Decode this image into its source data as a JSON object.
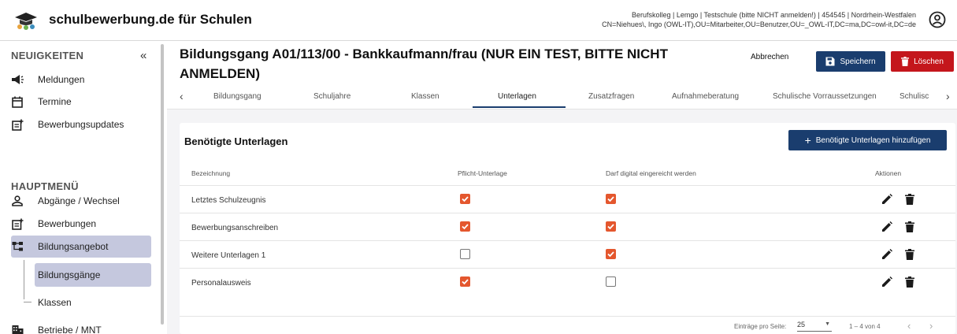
{
  "header": {
    "brand": "schulbewerbung.de für Schulen",
    "user_line1": "Berufskolleg | Lemgo | Testschule (bitte NICHT anmelden!) | 454545 | Nordrhein-Westfalen",
    "user_line2": "CN=Niehues\\, Ingo (OWL-IT),OU=Mitarbeiter,OU=Benutzer,OU=_OWL-IT,DC=ma,DC=owl-it,DC=de"
  },
  "sidebar": {
    "news_heading": "NEUIGKEITEN",
    "collapse_icon": "«",
    "news_items": [
      {
        "label": "Meldungen",
        "icon": "megaphone-icon"
      },
      {
        "label": "Termine",
        "icon": "calendar-icon"
      },
      {
        "label": "Bewerbungsupdates",
        "icon": "post-add-icon"
      }
    ],
    "main_heading": "HAUPTMENÜ",
    "main_items": [
      {
        "label": "Abgänge / Wechsel",
        "icon": "person-icon"
      },
      {
        "label": "Bewerbungen",
        "icon": "post-add-icon"
      },
      {
        "label": "Bildungsangebot",
        "icon": "hierarchy-icon"
      }
    ],
    "sub_items": [
      {
        "label": "Bildungsgänge"
      },
      {
        "label": "Klassen"
      }
    ],
    "last_item": {
      "label": "Betriebe / MNT",
      "icon": "building-icon"
    }
  },
  "page": {
    "title": "Bildungsgang A01/113/00 - Bankkaufmann/frau (NUR EIN TEST, BITTE NICHT ANMELDEN)",
    "cancel_label": "Abbrechen",
    "save_label": "Speichern",
    "delete_label": "Löschen"
  },
  "tabs": [
    "Bildungsgang",
    "Schuljahre",
    "Klassen",
    "Unterlagen",
    "Zusatzfragen",
    "Aufnahmeberatung",
    "Schulische Vorraussetzungen",
    "Schulisc"
  ],
  "active_tab": "Unterlagen",
  "card": {
    "title": "Benötigte Unterlagen",
    "add_label": "Benötigte Unterlagen hinzufügen",
    "columns": {
      "name": "Bezeichnung",
      "mandatory": "Pflicht-Unterlage",
      "digital": "Darf digital eingereicht werden",
      "actions": "Aktionen"
    },
    "rows": [
      {
        "name": "Letztes Schulzeugnis",
        "mandatory": true,
        "digital": true
      },
      {
        "name": "Bewerbungsanschreiben",
        "mandatory": true,
        "digital": true
      },
      {
        "name": "Weitere Unterlagen 1",
        "mandatory": false,
        "digital": true
      },
      {
        "name": "Personalausweis",
        "mandatory": true,
        "digital": false
      }
    ]
  },
  "pagination": {
    "per_page_label": "Einträge pro Seite:",
    "per_page_value": "25",
    "range": "1 – 4 von 4"
  },
  "colors": {
    "primary": "#1a3d6e",
    "danger": "#c4161c",
    "checkbox": "#e4572e",
    "active_nav": "#c5c8de"
  }
}
